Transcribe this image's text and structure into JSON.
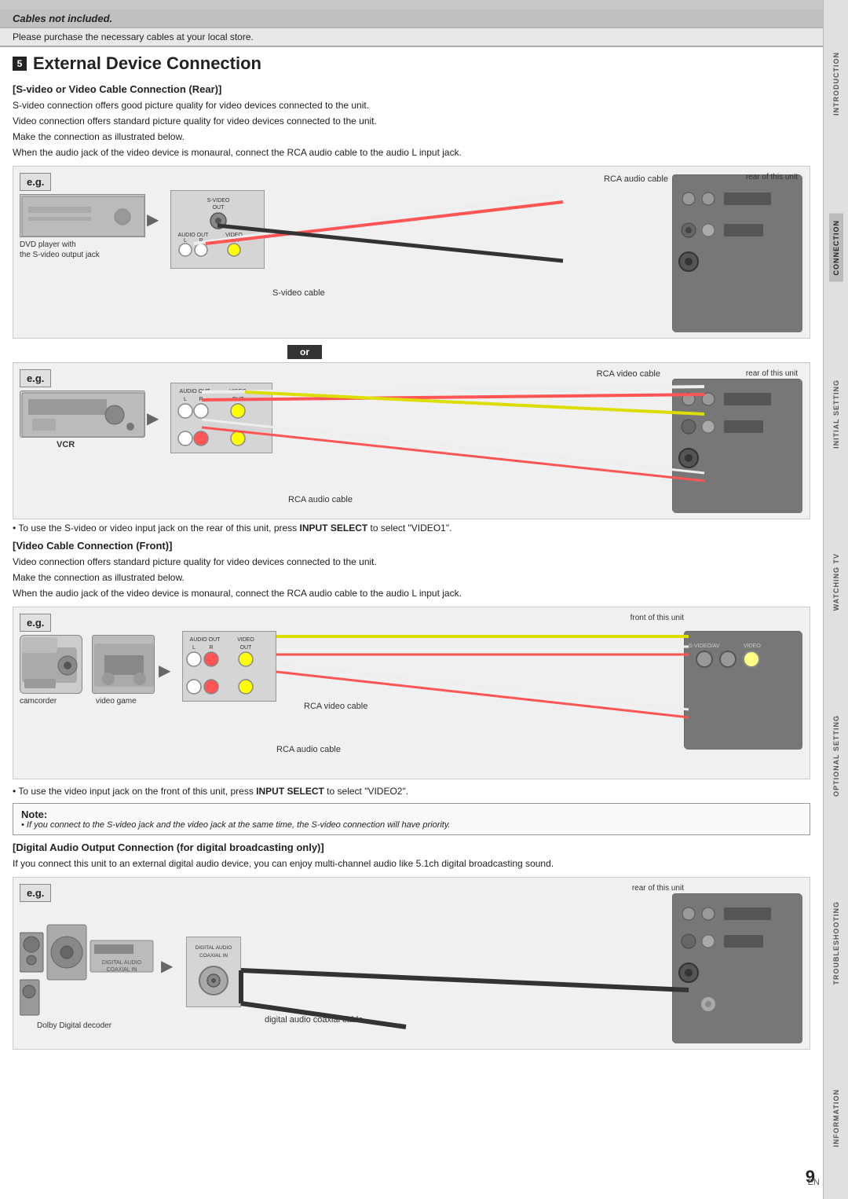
{
  "sidebar": {
    "tabs": [
      {
        "label": "INTRODUCTION",
        "active": false
      },
      {
        "label": "CONNECTION",
        "active": true
      },
      {
        "label": "INITIAL SETTING",
        "active": false
      },
      {
        "label": "WATCHING TV",
        "active": false
      },
      {
        "label": "OPTIONAL SETTING",
        "active": false
      },
      {
        "label": "TROUBLESHOOTING",
        "active": false
      },
      {
        "label": "INFORMATION",
        "active": false
      }
    ]
  },
  "top_bar_note": "gray decorative bar",
  "cables": {
    "title": "Cables not included.",
    "subtitle": "Please purchase the necessary cables at your local store."
  },
  "page_title": "External Device Connection",
  "page_number": "9",
  "page_lang": "EN",
  "sections": [
    {
      "id": "s_video_rear",
      "header": "[S-video or Video Cable Connection (Rear)]",
      "lines": [
        "S-video connection offers good picture quality for video devices connected to the unit.",
        "Video connection offers standard picture quality for video devices connected to the unit.",
        "Make the connection as illustrated below.",
        "When the audio jack of the video device is monaural, connect the RCA audio cable to the audio L input jack."
      ],
      "diagram": {
        "left_label": "e.g.",
        "device_label": "DVD player with\nthe S-video output jack",
        "cable1_label": "RCA audio cable",
        "cable2_label": "S-video cable",
        "cable3_label": "RCA video cable",
        "cable4_label": "RCA audio cable",
        "rear_label1": "rear of this unit",
        "rear_label2": "rear of this unit",
        "connector_labels": [
          "AUDIO OUT",
          "VIDEO OUT",
          "S-VIDEO OUT"
        ],
        "vcr_label": "VCR"
      },
      "bullet": "• To use the S-video or video input jack on the rear of this unit, press [INPUT SELECT] to select \"VIDEO1\".",
      "bullet_bold": "INPUT SELECT"
    },
    {
      "id": "video_cable_front",
      "header": "[Video Cable Connection (Front)]",
      "lines": [
        "Video connection offers standard picture quality for video devices connected to the unit.",
        "Make the connection as illustrated below.",
        "When the audio jack of the video device is monaural, connect the RCA audio cable to the audio L input jack."
      ],
      "diagram": {
        "left_label": "e.g.",
        "device_label1": "camcorder",
        "device_label2": "video game",
        "cable1_label": "RCA video cable",
        "cable2_label": "RCA audio cable",
        "front_label": "front of this unit",
        "connector_labels": [
          "AUDIO OUT L",
          "R",
          "VIDEO OUT"
        ]
      },
      "bullet": "• To use the video input jack on the front of this unit, press [INPUT SELECT] to select \"VIDEO2\".",
      "bullet_bold": "INPUT SELECT"
    }
  ],
  "note": {
    "title": "Note:",
    "text": "• If you connect to the S-video jack and the video jack at the same time, the S-video connection will have priority."
  },
  "digital_audio": {
    "header": "[Digital Audio Output Connection (for digital broadcasting only)]",
    "lines": [
      "If you connect this unit to an external digital audio device, you can enjoy multi-channel audio like 5.1ch digital broadcasting sound."
    ],
    "diagram": {
      "left_label": "e.g.",
      "device_label": "Dolby Digital decoder",
      "cable_label": "digital audio coaxial cable",
      "rear_label": "rear of this unit",
      "connector_label": "DIGITAL AUDIO\nCOAXIAL IN"
    }
  }
}
